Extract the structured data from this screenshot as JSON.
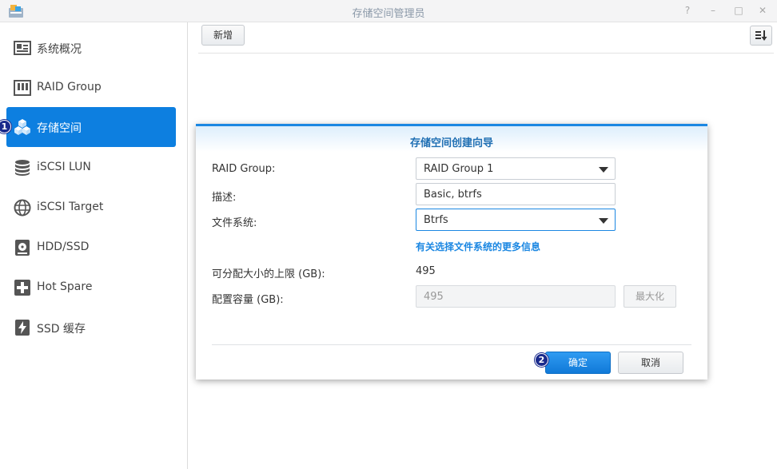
{
  "window": {
    "title": "存储空间管理员",
    "controls": [
      "?",
      "–",
      "□",
      "✕"
    ]
  },
  "sidebar": {
    "items": [
      {
        "label": "系统概况",
        "icon": "overview-icon"
      },
      {
        "label": "RAID Group",
        "icon": "raid-group-icon"
      },
      {
        "label": "存储空间",
        "icon": "volume-cubes-icon",
        "active": true
      },
      {
        "label": "iSCSI LUN",
        "icon": "database-icon"
      },
      {
        "label": "iSCSI Target",
        "icon": "globe-icon"
      },
      {
        "label": "HDD/SSD",
        "icon": "hdd-icon"
      },
      {
        "label": "Hot Spare",
        "icon": "plus-box-icon"
      },
      {
        "label": "SSD 缓存",
        "icon": "lightning-drive-icon"
      }
    ],
    "step_badge": "1"
  },
  "toolbar": {
    "create_label": "新增"
  },
  "dialog": {
    "title": "存储空间创建向导",
    "raid_group_label": "RAID Group:",
    "raid_group_value": "RAID Group 1",
    "description_label": "描述:",
    "description_value": "Basic, btrfs",
    "filesystem_label": "文件系统:",
    "filesystem_value": "Btrfs",
    "filesystem_info_link": "有关选择文件系统的更多信息",
    "max_alloc_label": "可分配大小的上限 (GB):",
    "max_alloc_value": "495",
    "capacity_label": "配置容量 (GB):",
    "capacity_value": "495",
    "maximize_label": "最大化",
    "ok_label": "确定",
    "cancel_label": "取消",
    "step_badge": "2"
  },
  "colors": {
    "accent": "#0d7fe0",
    "badge": "#1a2a8c",
    "link": "#1b87e2"
  }
}
